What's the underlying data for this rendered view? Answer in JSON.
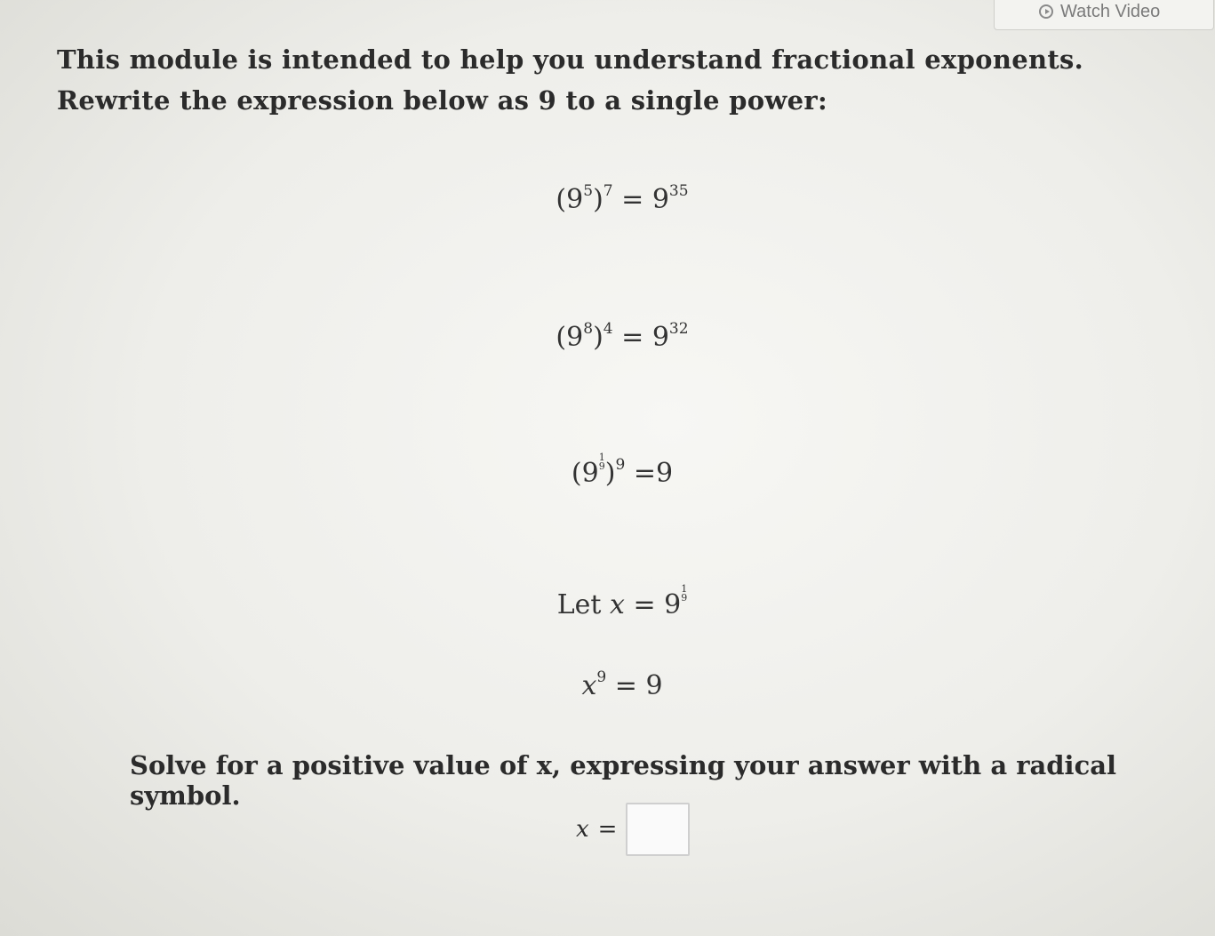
{
  "header": {
    "watch_video_label": "Watch Video"
  },
  "intro": {
    "line1": "This module is intended to help you understand fractional exponents.",
    "line2": "Rewrite the expression below as 9 to a single power:"
  },
  "equations": {
    "eq1": {
      "base": "9",
      "inner_exp": "5",
      "outer_exp": "7",
      "rhs_base": "9",
      "rhs_exp": "35"
    },
    "eq2": {
      "base": "9",
      "inner_exp": "8",
      "outer_exp": "4",
      "rhs_base": "9",
      "rhs_exp": "32"
    },
    "eq3": {
      "base": "9",
      "frac_num": "1",
      "frac_den": "9",
      "outer_exp": "9",
      "rhs": "9"
    },
    "let": {
      "prefix": "Let",
      "var": "x",
      "base": "9",
      "frac_num": "1",
      "frac_den": "9"
    },
    "power": {
      "var": "x",
      "exp": "9",
      "rhs": "9"
    }
  },
  "solve": {
    "text": "Solve for a positive value of x, expressing your answer with a radical symbol.",
    "answer_var": "x"
  }
}
